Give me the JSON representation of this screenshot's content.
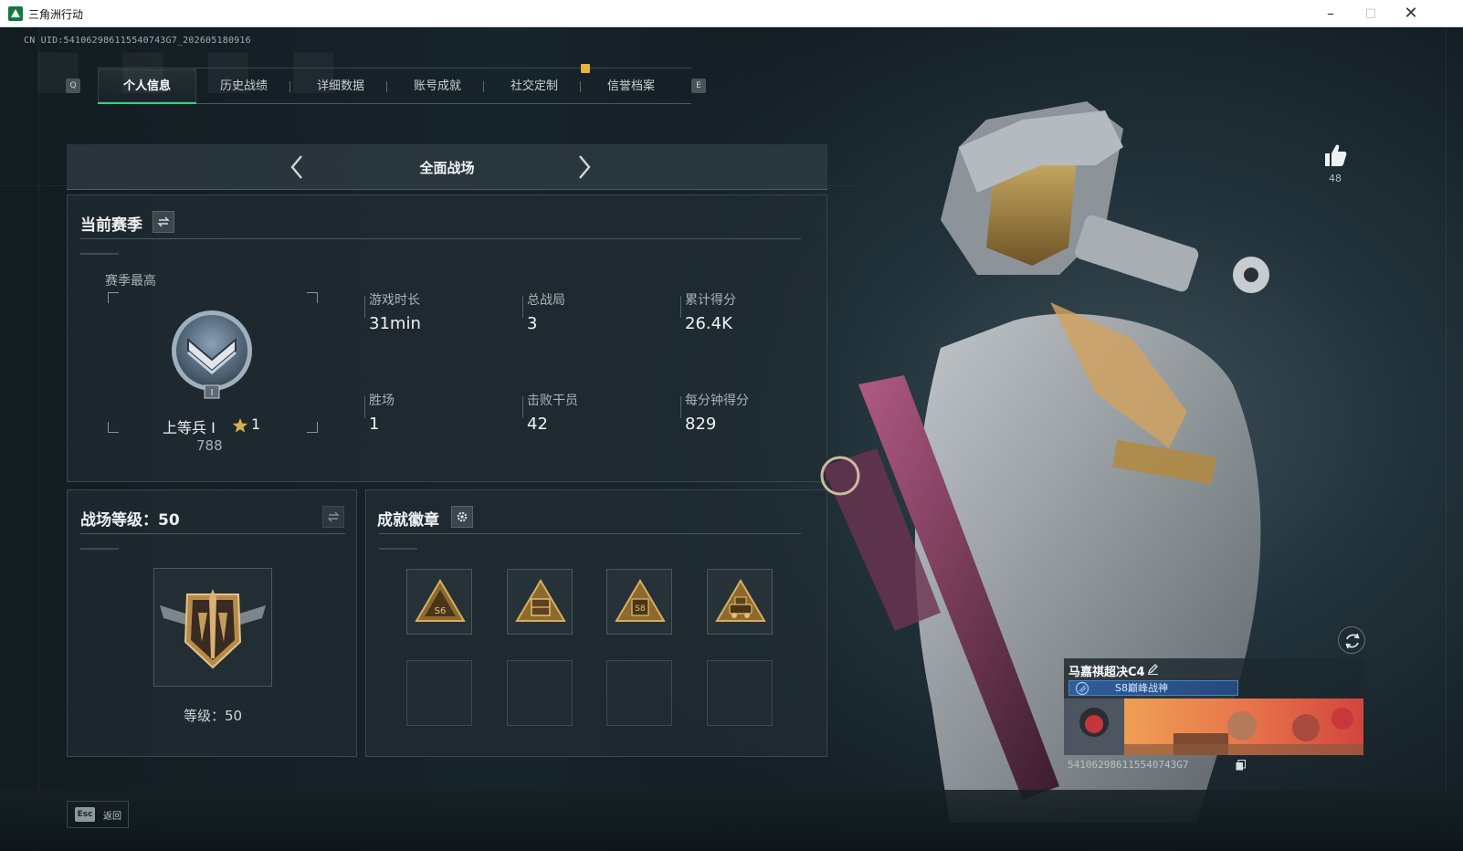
{
  "window": {
    "title": "三角洲行动"
  },
  "uid_line": "CN UID:541062986115540743G7_202605180916",
  "tabs": [
    {
      "label": "个人信息",
      "active": true
    },
    {
      "label": "历史战绩"
    },
    {
      "label": "详细数据"
    },
    {
      "label": "账号成就"
    },
    {
      "label": "社交定制"
    },
    {
      "label": "信誉档案"
    }
  ],
  "tab_keys": {
    "left": "Q",
    "right": "E"
  },
  "mode": {
    "label": "全面战场"
  },
  "season": {
    "title": "当前赛季",
    "best_label": "赛季最高",
    "rank_name": "上等兵 I",
    "stars": "1",
    "rank_points": "788",
    "stats": [
      {
        "label": "游戏时长",
        "value": "31min"
      },
      {
        "label": "总战局",
        "value": "3"
      },
      {
        "label": "累计得分",
        "value": "26.4K"
      },
      {
        "label": "胜场",
        "value": "1"
      },
      {
        "label": "击败干员",
        "value": "42"
      },
      {
        "label": "每分钟得分",
        "value": "829"
      }
    ]
  },
  "battlefield_level": {
    "title": "战场等级：50",
    "level_text": "等级：50"
  },
  "achievements": {
    "title": "成就徽章",
    "badges": [
      {
        "name": "S6 badge",
        "tag": "S6"
      },
      {
        "name": "crate badge",
        "tag": ""
      },
      {
        "name": "S8 badge",
        "tag": "S8"
      },
      {
        "name": "vehicle badge",
        "tag": ""
      }
    ],
    "empty_slots": 4
  },
  "profile": {
    "likes": "48",
    "player_name": "马嘉祺超决C4",
    "title_tag": "S8巅峰战神",
    "uid": "541062986115540743G7"
  },
  "footer": {
    "esc_key": "Esc",
    "esc_label": "返回"
  },
  "colors": {
    "accent_green": "#32d08c",
    "gold": "#e5b53a",
    "title_blue": "#2f5e9a"
  },
  "icons": [
    "app-icon",
    "minimize-icon",
    "maximize-icon",
    "close-icon",
    "chevron-left-icon",
    "chevron-right-icon",
    "switch-icon",
    "settings-icon",
    "thumbs-up-icon",
    "refresh-icon",
    "edit-icon",
    "copy-icon",
    "star-icon"
  ]
}
